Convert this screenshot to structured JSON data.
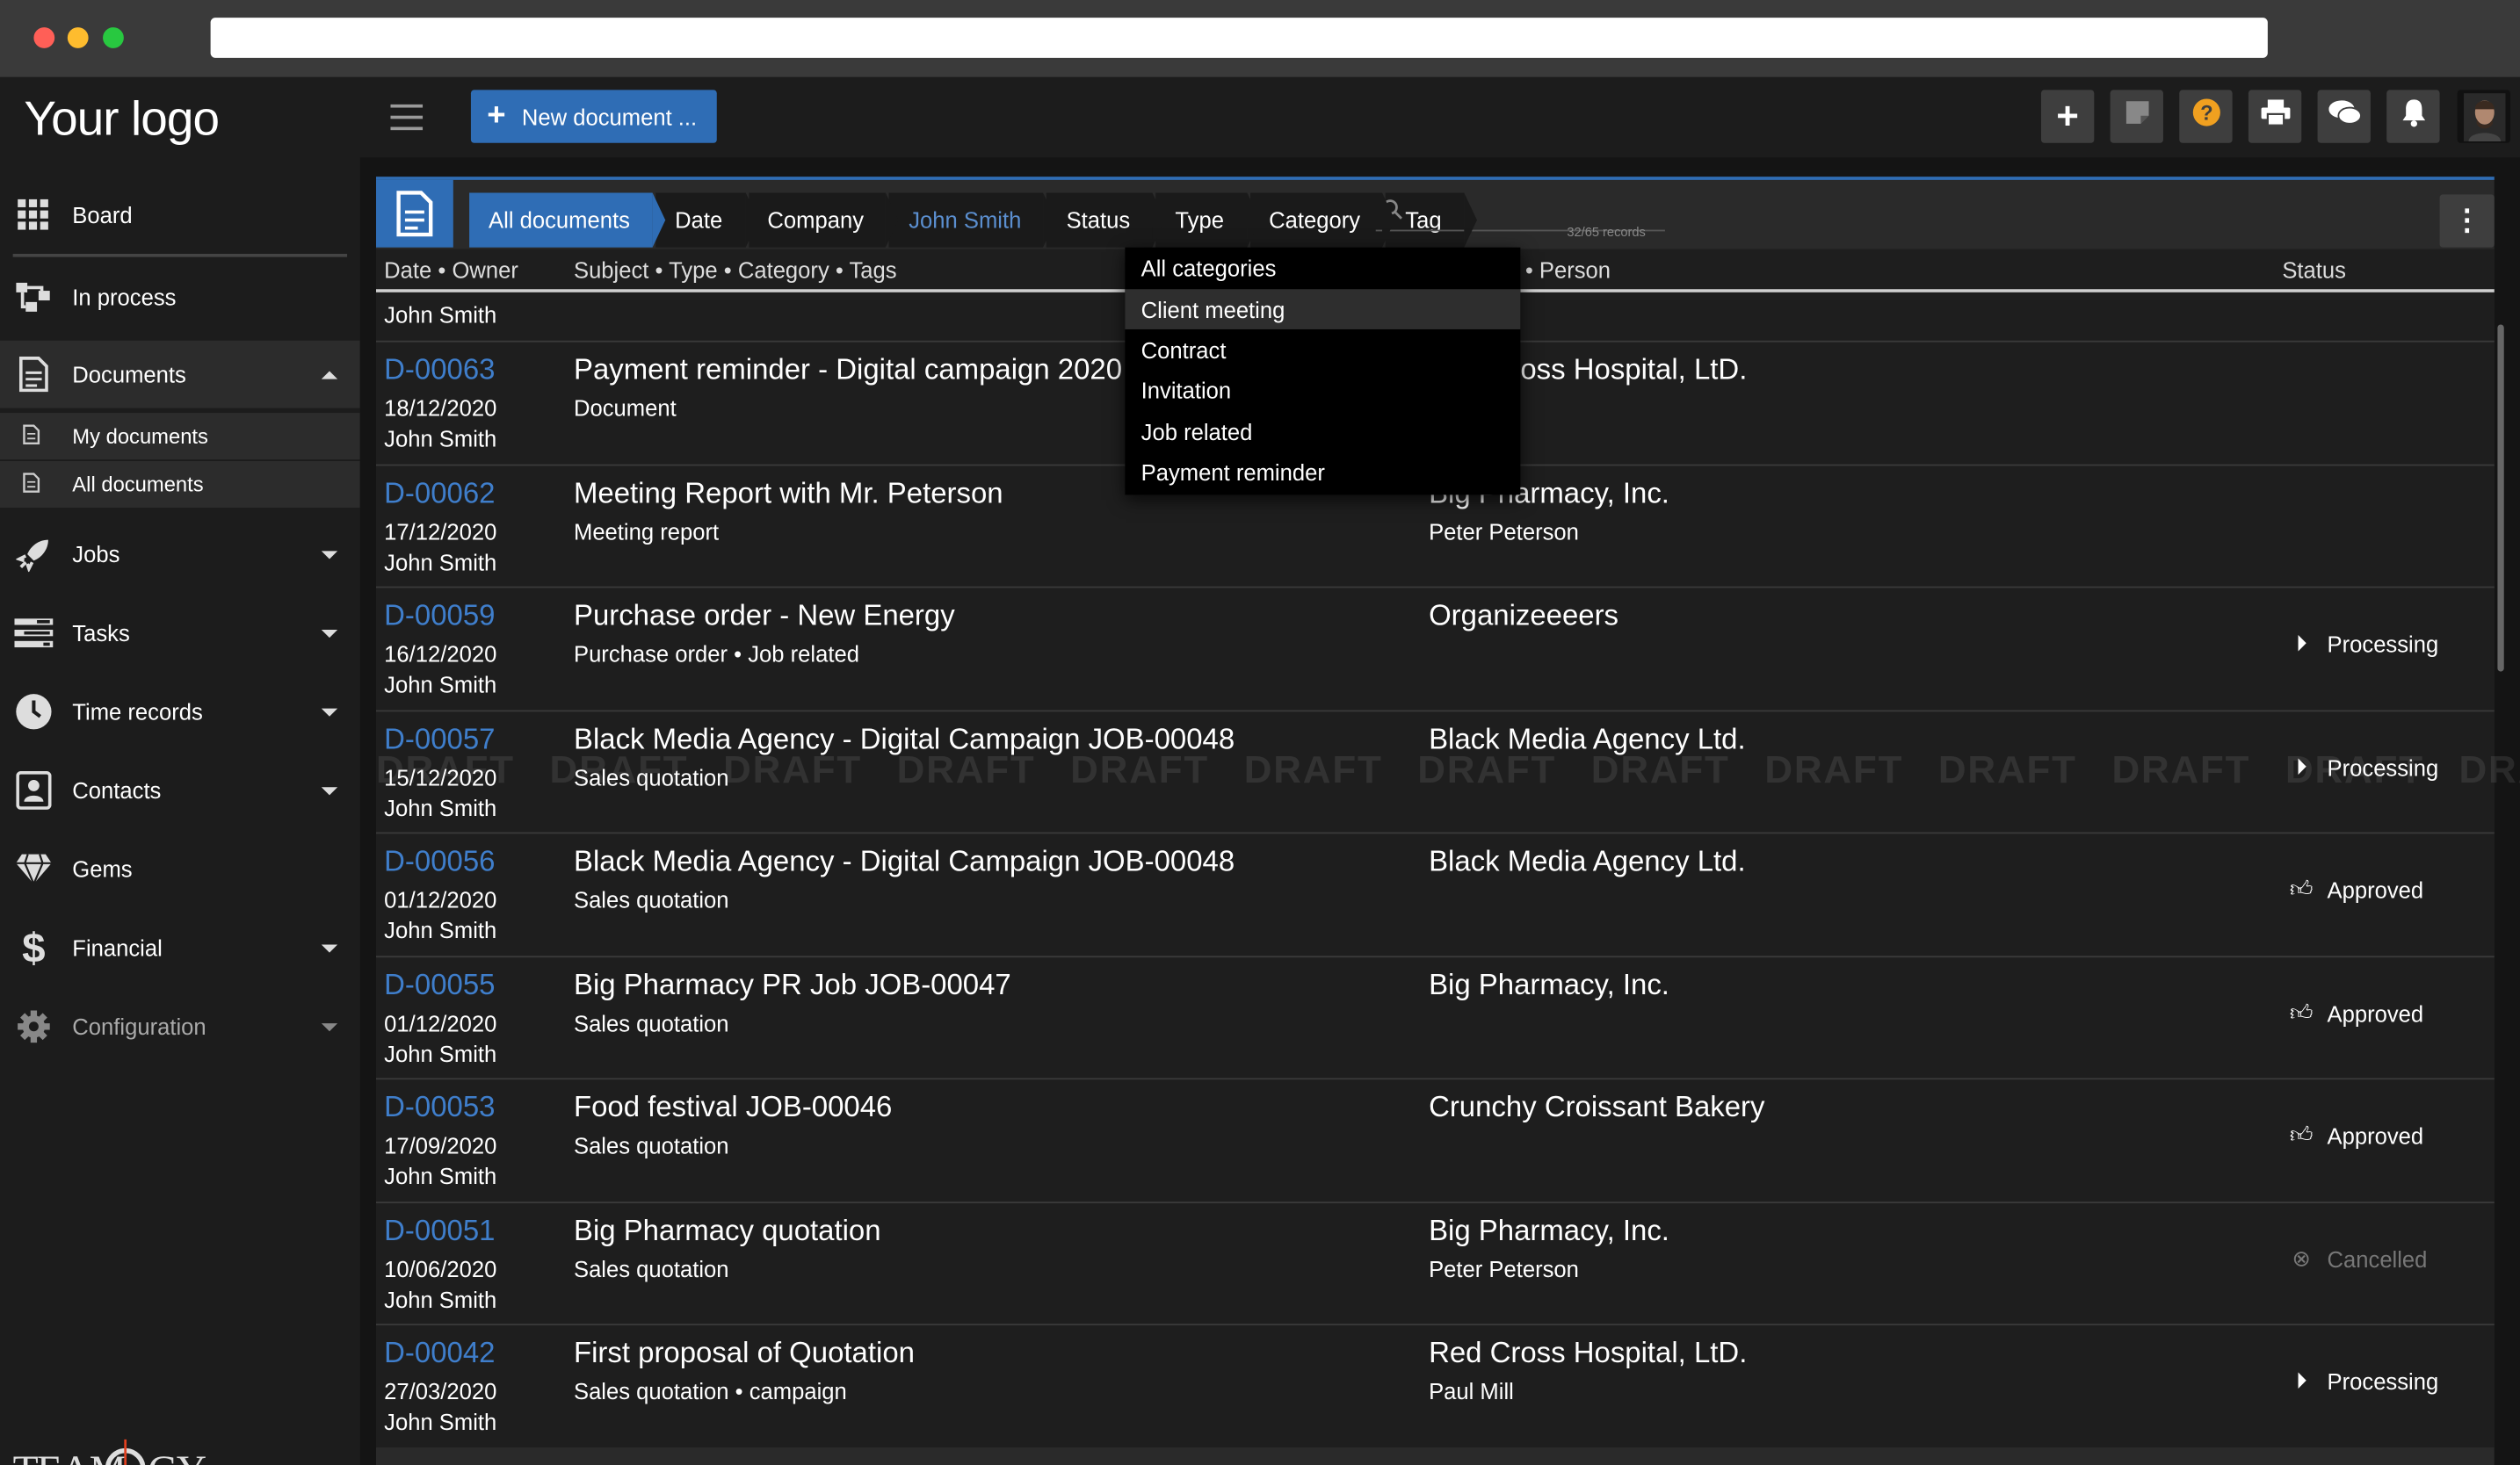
{
  "browser": {
    "traffic_lights": [
      "#ff5f57",
      "#febc2e",
      "#28c840"
    ]
  },
  "sidebar": {
    "logo": "Your logo",
    "items": [
      {
        "label": "Board",
        "icon": "grid-icon"
      },
      {
        "label": "In process",
        "icon": "flow-icon"
      },
      {
        "label": "Documents",
        "icon": "document-icon",
        "expanded": true
      },
      {
        "label": "Jobs",
        "icon": "rocket-icon"
      },
      {
        "label": "Tasks",
        "icon": "tasks-icon"
      },
      {
        "label": "Time records",
        "icon": "clock-icon"
      },
      {
        "label": "Contacts",
        "icon": "contact-card-icon"
      },
      {
        "label": "Gems",
        "icon": "gem-icon"
      },
      {
        "label": "Financial",
        "icon": "dollar-icon"
      },
      {
        "label": "Configuration",
        "icon": "gear-icon"
      }
    ],
    "sub_items": [
      "My documents",
      "All documents"
    ],
    "brand": "TEAMOGY"
  },
  "toolbar": {
    "new_document_label": "New document ...",
    "icons": [
      "plus-icon",
      "note-icon",
      "help-icon",
      "print-icon",
      "chat-icon",
      "bell-icon",
      "avatar"
    ],
    "help_color": "#f0a020"
  },
  "filters": {
    "crumbs": [
      "All documents",
      "Date",
      "Company",
      "John Smith",
      "Status",
      "Type",
      "Category",
      "Tag"
    ],
    "records": "32/65 records"
  },
  "table": {
    "headers": {
      "date_owner": "Date • Owner",
      "subject": "Subject • Type • Category • Tags",
      "company": "• Person",
      "status": "Status"
    },
    "group": "John Smith",
    "rows": [
      {
        "id": "D-00063",
        "date": "18/12/2020",
        "owner": "John Smith",
        "subject": "Payment reminder - Digital campaign 2020",
        "type": "Document",
        "company": "Red Cross Hospital, LtD.",
        "person": "",
        "status": "",
        "status_icon": ""
      },
      {
        "id": "D-00062",
        "date": "17/12/2020",
        "owner": "John Smith",
        "subject": "Meeting Report with Mr. Peterson",
        "type": "Meeting report",
        "company": "Big Pharmacy, Inc.",
        "person": "Peter Peterson",
        "status": "",
        "status_icon": ""
      },
      {
        "id": "D-00059",
        "date": "16/12/2020",
        "owner": "John Smith",
        "subject": "Purchase order - New Energy",
        "type": "Purchase order • Job related",
        "company": "Organizeeeers",
        "person": "",
        "status": "Processing",
        "status_icon": "play-circle-icon"
      },
      {
        "id": "D-00057",
        "date": "15/12/2020",
        "owner": "John Smith",
        "subject": "Black Media Agency - Digital Campaign JOB-00048",
        "type": "Sales quotation",
        "company": "Black Media Agency Ltd.",
        "person": "",
        "status": "Processing",
        "status_icon": "play-circle-icon",
        "watermark": "DRAFT"
      },
      {
        "id": "D-00056",
        "date": "01/12/2020",
        "owner": "John Smith",
        "subject": "Black Media Agency - Digital Campaign JOB-00048",
        "type": "Sales quotation",
        "company": "Black Media Agency Ltd.",
        "person": "",
        "status": "Approved",
        "status_icon": "thumbs-up-icon"
      },
      {
        "id": "D-00055",
        "date": "01/12/2020",
        "owner": "John Smith",
        "subject": "Big Pharmacy PR Job JOB-00047",
        "type": "Sales quotation",
        "company": "Big Pharmacy, Inc.",
        "person": "",
        "status": "Approved",
        "status_icon": "thumbs-up-icon"
      },
      {
        "id": "D-00053",
        "date": "17/09/2020",
        "owner": "John Smith",
        "subject": "Food festival JOB-00046",
        "type": "Sales quotation",
        "company": "Crunchy Croissant Bakery",
        "person": "",
        "status": "Approved",
        "status_icon": "thumbs-up-icon"
      },
      {
        "id": "D-00051",
        "date": "10/06/2020",
        "owner": "John Smith",
        "subject": "Big Pharmacy quotation",
        "type": "Sales quotation",
        "company": "Big Pharmacy, Inc.",
        "person": "Peter Peterson",
        "status": "Cancelled",
        "status_icon": "x-circle-icon"
      },
      {
        "id": "D-00042",
        "date": "27/03/2020",
        "owner": "John Smith",
        "subject": "First proposal of Quotation",
        "type": "Sales quotation • campaign",
        "company": "Red Cross Hospital, LtD.",
        "person": "Paul Mill",
        "status": "Processing",
        "status_icon": "play-circle-icon"
      }
    ]
  },
  "dropdown": {
    "items": [
      "All categories",
      "Client meeting",
      "Contract",
      "Invitation",
      "Job related",
      "Payment reminder"
    ],
    "highlighted": "Client meeting"
  }
}
